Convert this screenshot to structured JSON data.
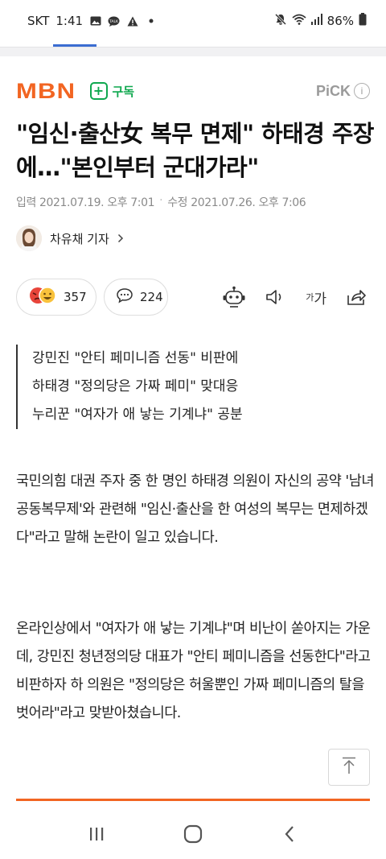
{
  "status_bar": {
    "carrier": "SKT",
    "time": "1:41",
    "battery": "86%",
    "left_icons": [
      "gallery-icon",
      "talk-icon",
      "warning-icon",
      "dot-icon"
    ],
    "right_icons": [
      "mute-icon",
      "wifi-icon",
      "signal-icon",
      "battery-icon"
    ]
  },
  "publisher": {
    "logo": "MBN",
    "subscribe_label": "구독",
    "pick_label": "PiCK",
    "info_label": "i",
    "brand_color": "#f26522",
    "subscribe_color": "#0fa84f"
  },
  "article": {
    "headline": "\"임신·출산女 복무 면제\" 하태경 주장에…\"본인부터 군대가라\"",
    "published": "입력 2021.07.19. 오후 7:01",
    "updated": "수정 2021.07.26. 오후 7:06",
    "reporter": "차유채 기자",
    "reaction_count": "357",
    "comment_count": "224",
    "summary": [
      "강민진 \"안티 페미니즘 선동\" 비판에",
      "하태경 \"정의당은 가짜 페미\" 맞대응",
      "누리꾼 \"여자가 애 낳는 기계냐\" 공분"
    ],
    "paragraphs": [
      "국민의힘 대권 주자 중 한 명인 하태경 의원이 자신의 공약 '남녀공동복무제'와 관련해 \"임신·출산을 한 여성의 복무는 면제하겠다\"라고 말해 논란이 일고 있습니다.",
      "온라인상에서 \"여자가 애 낳는 기계냐\"며 비난이 쏟아지는 가운데, 강민진 청년정의당 대표가 \"안티 페미니즘을 선동한다\"라고 비판하자 하 의원은 \"정의당은 허울뿐인 가짜 페미니즘의 탈을 벗어라\"라고 맞받아쳤습니다."
    ]
  },
  "toolbar": {
    "font_label_small": "가",
    "font_label_large": "가",
    "icons": [
      "robot-summary-icon",
      "speaker-icon",
      "font-size-icon",
      "share-icon"
    ]
  },
  "nav_bar": {
    "icons": [
      "recent-apps-icon",
      "home-icon",
      "back-icon"
    ]
  }
}
